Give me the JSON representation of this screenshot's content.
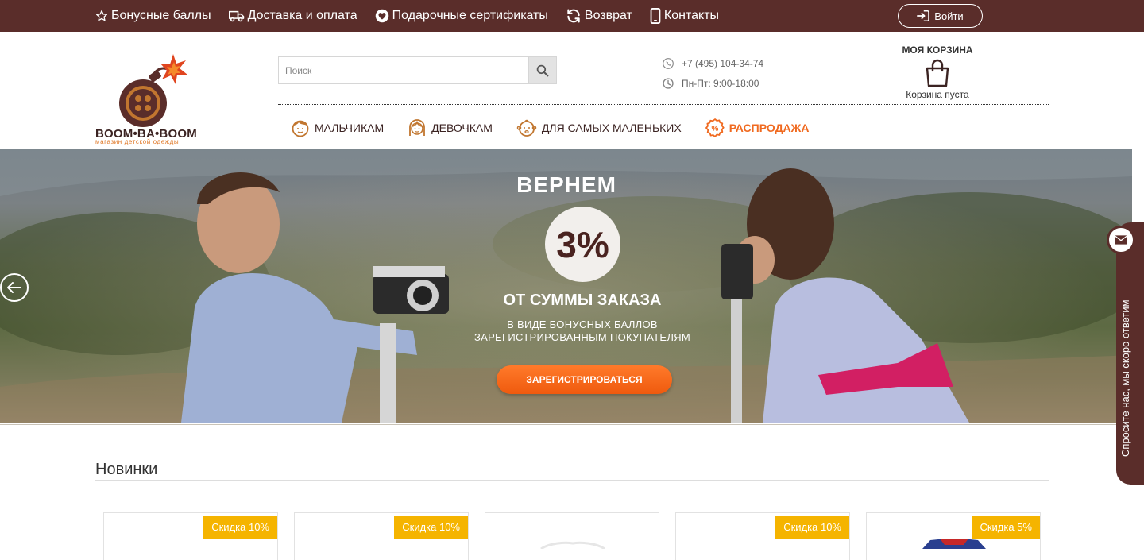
{
  "topnav": {
    "items": [
      {
        "label": "Бонусные баллы",
        "icon": "star-icon"
      },
      {
        "label": "Доставка и оплата",
        "icon": "truck-icon"
      },
      {
        "label": "Подарочные сертификаты",
        "icon": "heart-icon"
      },
      {
        "label": "Возврат",
        "icon": "refresh-icon"
      },
      {
        "label": "Контакты",
        "icon": "phone-icon"
      }
    ],
    "login_label": "Войти"
  },
  "brand": {
    "name": "BOOM•BA•BOOM",
    "tagline": "магазин детской одежды"
  },
  "search": {
    "placeholder": "Поиск",
    "value": ""
  },
  "contacts": {
    "phone": "+7 (495) 104-34-74",
    "hours": "Пн-Пт: 9:00-18:00"
  },
  "cart": {
    "title": "МОЯ КОРЗИНА",
    "status": "Корзина пуста"
  },
  "categories": [
    {
      "label": "МАЛЬЧИКАМ",
      "icon": "boy-face-icon"
    },
    {
      "label": "ДЕВОЧКАМ",
      "icon": "girl-face-icon"
    },
    {
      "label": "ДЛЯ САМЫХ МАЛЕНЬКИХ",
      "icon": "baby-face-icon"
    },
    {
      "label": "РАСПРОДАЖА",
      "icon": "percent-badge-icon"
    }
  ],
  "banner": {
    "title": "ВЕРНЕМ",
    "percent": "3%",
    "subtitle": "ОТ СУММЫ ЗАКАЗА",
    "line1": "В ВИДЕ БОНУСНЫХ БАЛЛОВ",
    "line2": "ЗАРЕГИСТРИРОВАННЫМ ПОКУПАТЕЛЯМ",
    "cta": "ЗАРЕГИСТРИРОВАТЬСЯ"
  },
  "feedback": {
    "label": "Спросите нас, мы скоро ответим"
  },
  "new_products": {
    "title": "Новинки",
    "items": [
      {
        "badge": "Скидка 10%"
      },
      {
        "badge": "Скидка 10%"
      },
      {
        "badge": ""
      },
      {
        "badge": "Скидка 10%"
      },
      {
        "badge": "Скидка 5%"
      }
    ]
  },
  "colors": {
    "brand_brown": "#5a2d2a",
    "accent_orange": "#f06a20",
    "badge_yellow": "#f5b400"
  }
}
